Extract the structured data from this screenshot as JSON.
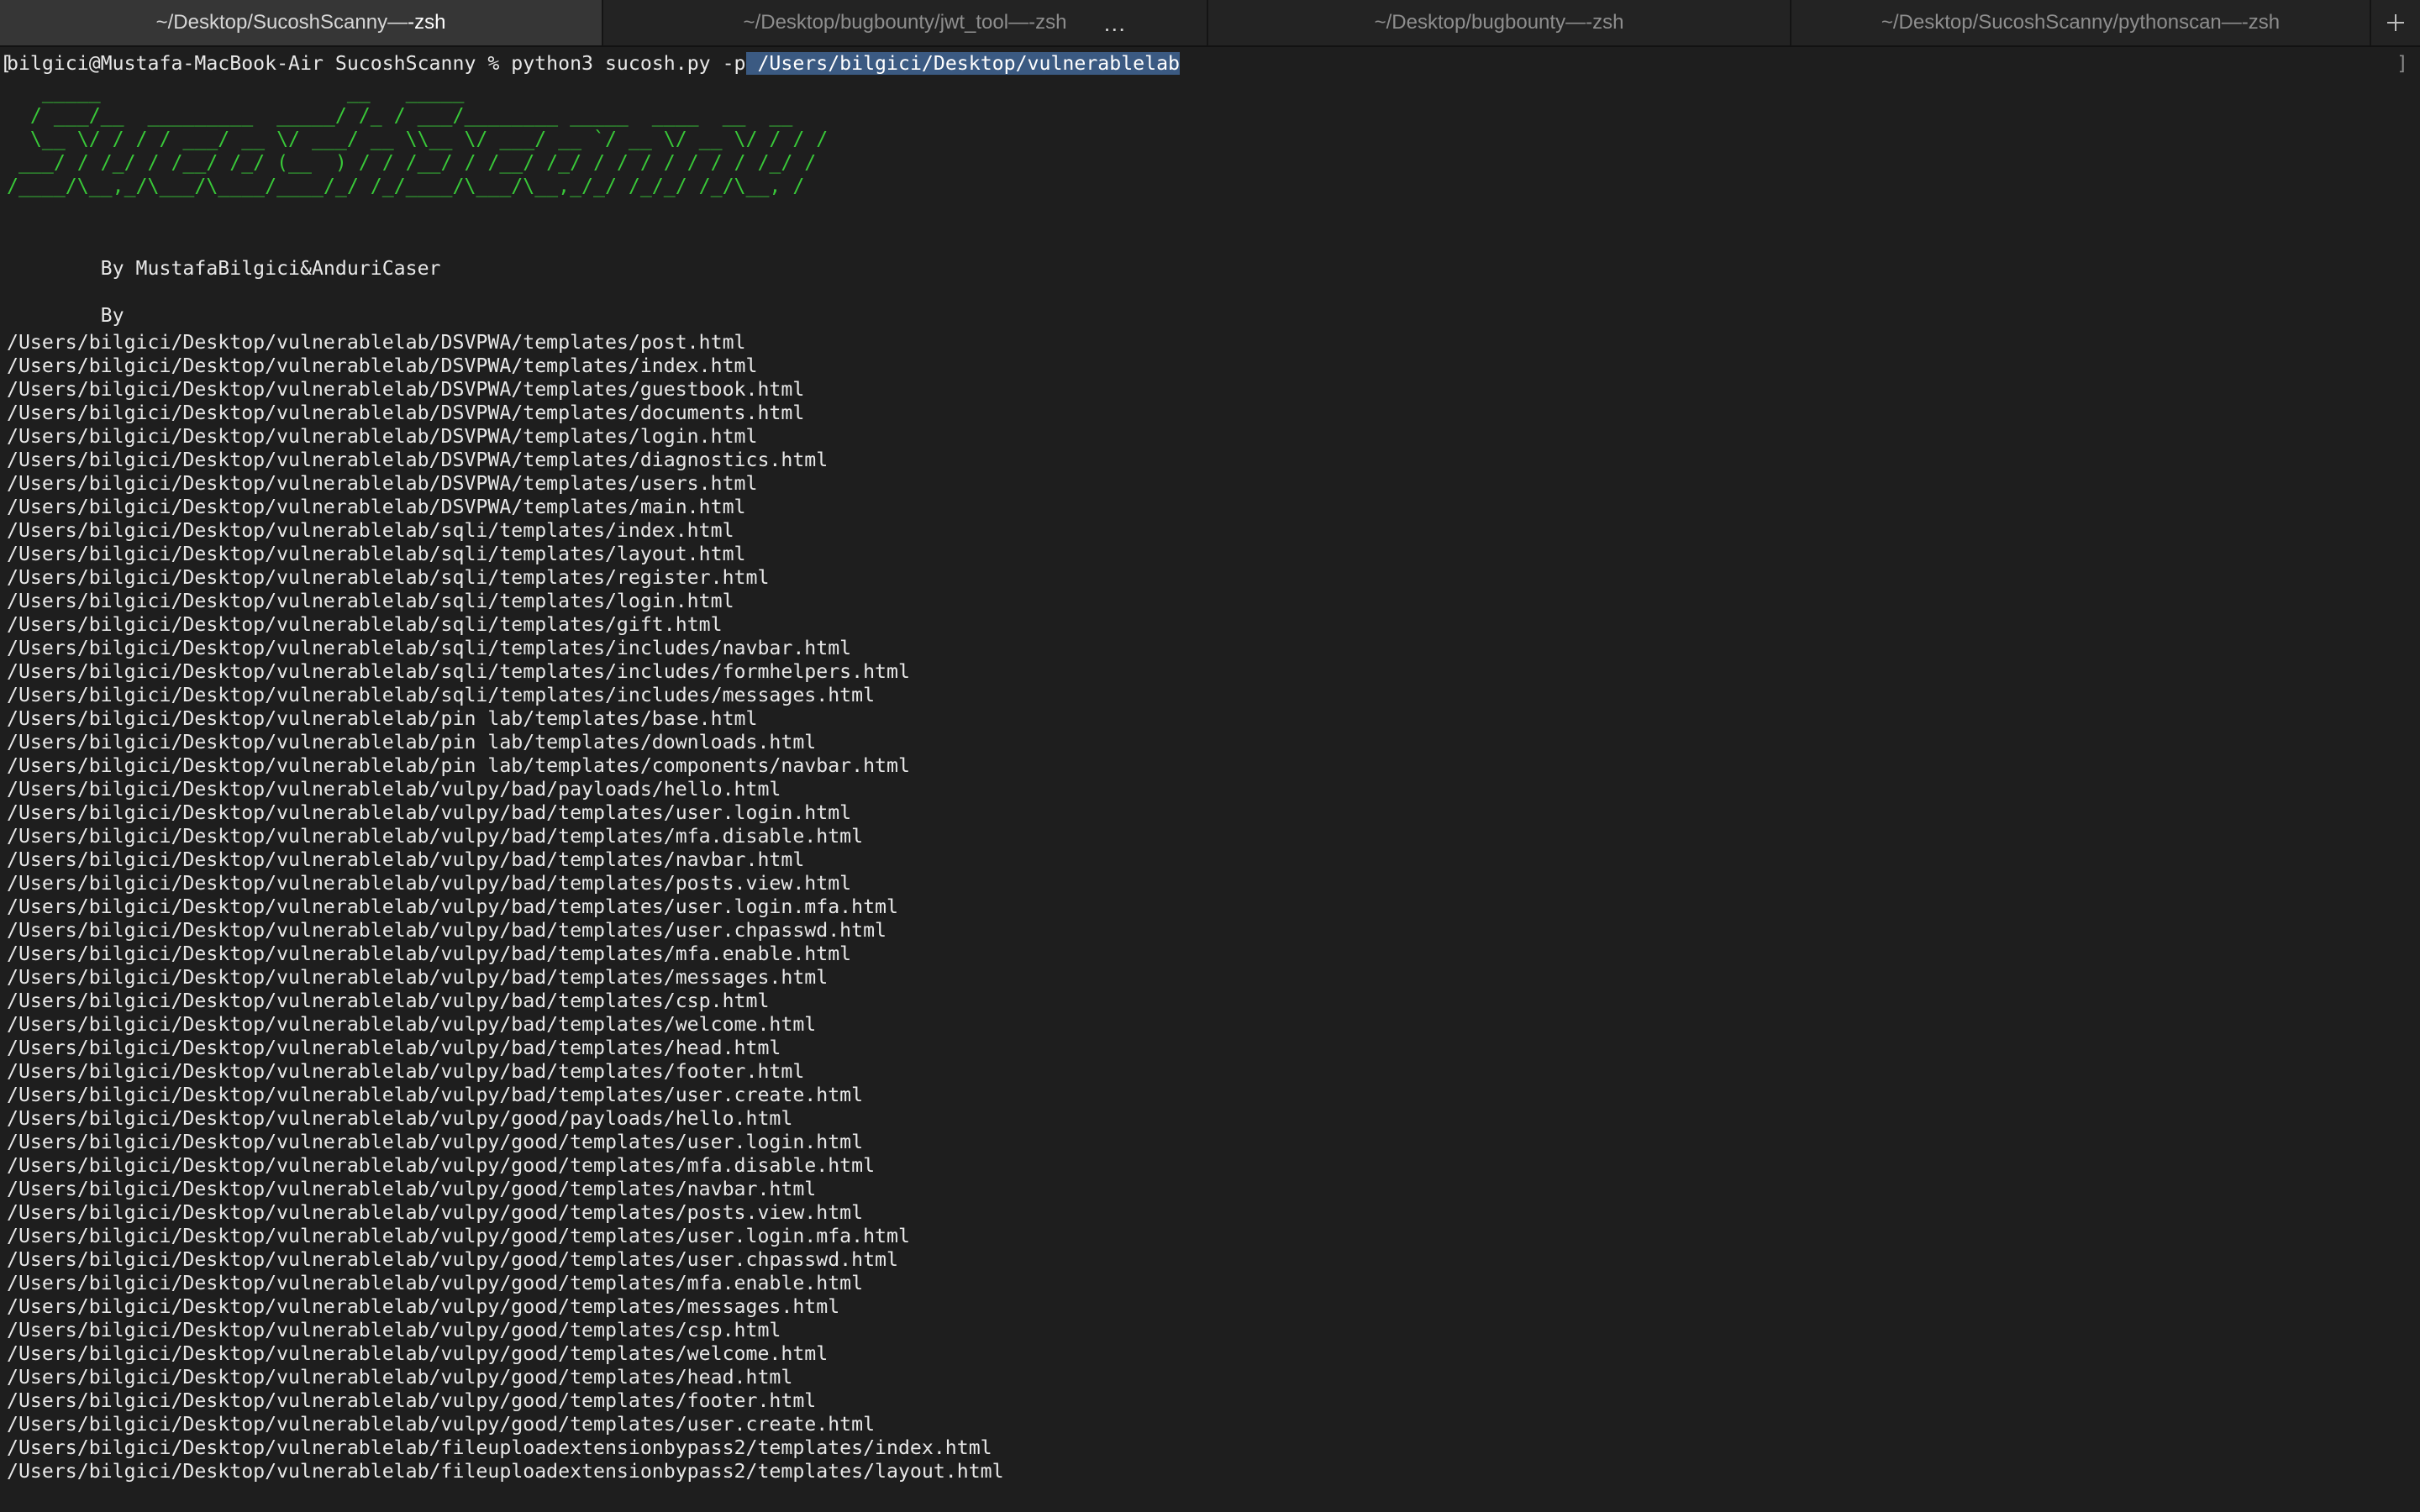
{
  "tabs": [
    {
      "dir": "~/Desktop/SucoshScanny",
      "separator": " — ",
      "shell": "-zsh",
      "active": true
    },
    {
      "dir": "~/Desktop/bugbounty/jwt_tool",
      "separator": " — ",
      "shell": "-zsh",
      "active": false,
      "overflow_indicator": "..."
    },
    {
      "dir": "~/Desktop/bugbounty",
      "separator": " — ",
      "shell": "-zsh",
      "active": false
    },
    {
      "dir": "~/Desktop/SucoshScanny/pythonscan",
      "separator": " — ",
      "shell": "-zsh",
      "active": false
    }
  ],
  "new_tab_icon": "plus-icon",
  "terminal": {
    "prompt": "bilgici@Mustafa-MacBook-Air SucoshScanny % ",
    "command": "python3 sucosh.py -p",
    "selected_argument": " /Users/bilgici/Desktop/vulnerablelab",
    "prompt_open_bracket": "[",
    "prompt_close_bracket": "]",
    "banner_lines": [
      "   _____                     __   _____                           ",
      "  / ___/__  _________  _____/ /_ / ___/________ _____  ____  __  __",
      "  \\__ \\/ / / / ___/ __ \\/ ___/ __ \\\\__ \\/ ___/ __ `/ __ \\/ __ \\/ / / /",
      " ___/ / /_/ / /__/ /_/ (__  ) / / /__/ / /__/ /_/ / / / / / / / /_/ / ",
      "/____/\\__,_/\\___/\\____/____/_/ /_/____/\\___/\\__,_/_/ /_/_/ /_/\\__, /  "
    ],
    "credits": "        By MustafaBilgici&AnduriCaser",
    "by_line": "        By",
    "output_lines": [
      "/Users/bilgici/Desktop/vulnerablelab/DSVPWA/templates/post.html",
      "/Users/bilgici/Desktop/vulnerablelab/DSVPWA/templates/index.html",
      "/Users/bilgici/Desktop/vulnerablelab/DSVPWA/templates/guestbook.html",
      "/Users/bilgici/Desktop/vulnerablelab/DSVPWA/templates/documents.html",
      "/Users/bilgici/Desktop/vulnerablelab/DSVPWA/templates/login.html",
      "/Users/bilgici/Desktop/vulnerablelab/DSVPWA/templates/diagnostics.html",
      "/Users/bilgici/Desktop/vulnerablelab/DSVPWA/templates/users.html",
      "/Users/bilgici/Desktop/vulnerablelab/DSVPWA/templates/main.html",
      "/Users/bilgici/Desktop/vulnerablelab/sqli/templates/index.html",
      "/Users/bilgici/Desktop/vulnerablelab/sqli/templates/layout.html",
      "/Users/bilgici/Desktop/vulnerablelab/sqli/templates/register.html",
      "/Users/bilgici/Desktop/vulnerablelab/sqli/templates/login.html",
      "/Users/bilgici/Desktop/vulnerablelab/sqli/templates/gift.html",
      "/Users/bilgici/Desktop/vulnerablelab/sqli/templates/includes/navbar.html",
      "/Users/bilgici/Desktop/vulnerablelab/sqli/templates/includes/formhelpers.html",
      "/Users/bilgici/Desktop/vulnerablelab/sqli/templates/includes/messages.html",
      "/Users/bilgici/Desktop/vulnerablelab/pin lab/templates/base.html",
      "/Users/bilgici/Desktop/vulnerablelab/pin lab/templates/downloads.html",
      "/Users/bilgici/Desktop/vulnerablelab/pin lab/templates/components/navbar.html",
      "/Users/bilgici/Desktop/vulnerablelab/vulpy/bad/payloads/hello.html",
      "/Users/bilgici/Desktop/vulnerablelab/vulpy/bad/templates/user.login.html",
      "/Users/bilgici/Desktop/vulnerablelab/vulpy/bad/templates/mfa.disable.html",
      "/Users/bilgici/Desktop/vulnerablelab/vulpy/bad/templates/navbar.html",
      "/Users/bilgici/Desktop/vulnerablelab/vulpy/bad/templates/posts.view.html",
      "/Users/bilgici/Desktop/vulnerablelab/vulpy/bad/templates/user.login.mfa.html",
      "/Users/bilgici/Desktop/vulnerablelab/vulpy/bad/templates/user.chpasswd.html",
      "/Users/bilgici/Desktop/vulnerablelab/vulpy/bad/templates/mfa.enable.html",
      "/Users/bilgici/Desktop/vulnerablelab/vulpy/bad/templates/messages.html",
      "/Users/bilgici/Desktop/vulnerablelab/vulpy/bad/templates/csp.html",
      "/Users/bilgici/Desktop/vulnerablelab/vulpy/bad/templates/welcome.html",
      "/Users/bilgici/Desktop/vulnerablelab/vulpy/bad/templates/head.html",
      "/Users/bilgici/Desktop/vulnerablelab/vulpy/bad/templates/footer.html",
      "/Users/bilgici/Desktop/vulnerablelab/vulpy/bad/templates/user.create.html",
      "/Users/bilgici/Desktop/vulnerablelab/vulpy/good/payloads/hello.html",
      "/Users/bilgici/Desktop/vulnerablelab/vulpy/good/templates/user.login.html",
      "/Users/bilgici/Desktop/vulnerablelab/vulpy/good/templates/mfa.disable.html",
      "/Users/bilgici/Desktop/vulnerablelab/vulpy/good/templates/navbar.html",
      "/Users/bilgici/Desktop/vulnerablelab/vulpy/good/templates/posts.view.html",
      "/Users/bilgici/Desktop/vulnerablelab/vulpy/good/templates/user.login.mfa.html",
      "/Users/bilgici/Desktop/vulnerablelab/vulpy/good/templates/user.chpasswd.html",
      "/Users/bilgici/Desktop/vulnerablelab/vulpy/good/templates/mfa.enable.html",
      "/Users/bilgici/Desktop/vulnerablelab/vulpy/good/templates/messages.html",
      "/Users/bilgici/Desktop/vulnerablelab/vulpy/good/templates/csp.html",
      "/Users/bilgici/Desktop/vulnerablelab/vulpy/good/templates/welcome.html",
      "/Users/bilgici/Desktop/vulnerablelab/vulpy/good/templates/head.html",
      "/Users/bilgici/Desktop/vulnerablelab/vulpy/good/templates/footer.html",
      "/Users/bilgici/Desktop/vulnerablelab/vulpy/good/templates/user.create.html",
      "/Users/bilgici/Desktop/vulnerablelab/fileuploadextensionbypass2/templates/index.html",
      "/Users/bilgici/Desktop/vulnerablelab/fileuploadextensionbypass2/templates/layout.html"
    ]
  },
  "colors": {
    "background": "#1e1e1e",
    "tabbar": "#262626",
    "active_tab": "#363636",
    "banner_green": "#39c839",
    "selection": "#3b5a82",
    "text": "#e8e8e8"
  }
}
